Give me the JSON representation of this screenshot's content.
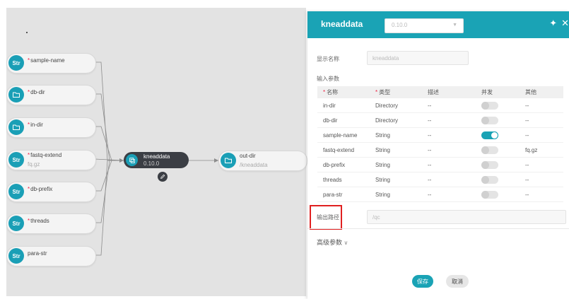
{
  "workflow": {
    "inputs": [
      {
        "type": "Str",
        "icon": "str-badge",
        "required": true,
        "label": "sample-name",
        "value": ""
      },
      {
        "type": "Dir",
        "icon": "folder-icon",
        "required": true,
        "label": "db-dir",
        "value": ""
      },
      {
        "type": "Dir",
        "icon": "folder-icon",
        "required": true,
        "label": "in-dir",
        "value": ""
      },
      {
        "type": "Str",
        "icon": "str-badge",
        "required": true,
        "label": "fastq-extend",
        "value": "fq.gz"
      },
      {
        "type": "Str",
        "icon": "str-badge",
        "required": true,
        "label": "db-prefix",
        "value": ""
      },
      {
        "type": "Str",
        "icon": "str-badge",
        "required": true,
        "label": "threads",
        "value": ""
      },
      {
        "type": "Str",
        "icon": "str-badge",
        "required": false,
        "label": "para-str",
        "value": ""
      }
    ],
    "tool": {
      "name": "kneaddata",
      "version": "0.10.0"
    },
    "output": {
      "label": "out-dir",
      "value": "/kneaddata"
    },
    "str_badge_text": "Str"
  },
  "panel": {
    "title": "kneaddata",
    "version": "0.10.0",
    "display_name_label": "显示名称",
    "display_name_value": "kneaddata",
    "input_params_label": "输入参数",
    "table": {
      "headers": {
        "name": "名称",
        "type": "类型",
        "desc": "描述",
        "concurrent": "并发",
        "other": "其他"
      },
      "rows": [
        {
          "name": "in-dir",
          "type": "Directory",
          "desc": "--",
          "concurrent": false,
          "other": "--"
        },
        {
          "name": "db-dir",
          "type": "Directory",
          "desc": "--",
          "concurrent": false,
          "other": "--"
        },
        {
          "name": "sample-name",
          "type": "String",
          "desc": "--",
          "concurrent": true,
          "other": "--"
        },
        {
          "name": "fastq-extend",
          "type": "String",
          "desc": "--",
          "concurrent": false,
          "other": "fq.gz"
        },
        {
          "name": "db-prefix",
          "type": "String",
          "desc": "--",
          "concurrent": false,
          "other": "--"
        },
        {
          "name": "threads",
          "type": "String",
          "desc": "--",
          "concurrent": false,
          "other": "--"
        },
        {
          "name": "para-str",
          "type": "String",
          "desc": "--",
          "concurrent": false,
          "other": "--"
        }
      ]
    },
    "output_path_label": "输出路径",
    "output_path_value": "/qc",
    "advanced_label": "高级参数",
    "save_label": "保存",
    "cancel_label": "取消"
  },
  "colors": {
    "accent": "#1aa3b5",
    "highlight": "#e02020",
    "tool_node": "#3b3e44"
  }
}
